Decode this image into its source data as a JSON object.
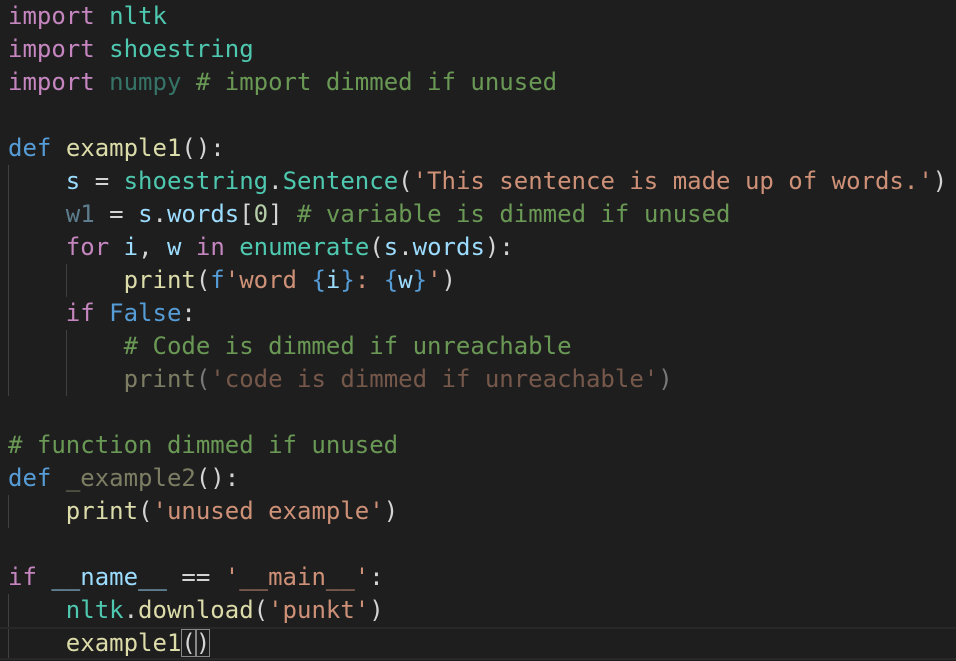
{
  "editor": {
    "lines": [
      [
        {
          "t": "import",
          "c": "kw"
        },
        {
          "t": " ",
          "c": "txt"
        },
        {
          "t": "nltk",
          "c": "mod"
        }
      ],
      [
        {
          "t": "import",
          "c": "kw"
        },
        {
          "t": " ",
          "c": "txt"
        },
        {
          "t": "shoestring",
          "c": "mod"
        }
      ],
      [
        {
          "t": "import",
          "c": "kw"
        },
        {
          "t": " ",
          "c": "txt"
        },
        {
          "t": "numpy",
          "c": "mod-dim"
        },
        {
          "t": " ",
          "c": "txt"
        },
        {
          "t": "# import dimmed if unused",
          "c": "cmt"
        }
      ],
      [],
      [
        {
          "t": "def",
          "c": "def"
        },
        {
          "t": " ",
          "c": "txt"
        },
        {
          "t": "example1",
          "c": "fn"
        },
        {
          "t": "():",
          "c": "txt"
        }
      ],
      [
        {
          "t": "    ",
          "c": "txt"
        },
        {
          "t": "s",
          "c": "var"
        },
        {
          "t": " = ",
          "c": "txt"
        },
        {
          "t": "shoestring",
          "c": "mod"
        },
        {
          "t": ".",
          "c": "txt"
        },
        {
          "t": "Sentence",
          "c": "mod"
        },
        {
          "t": "(",
          "c": "txt"
        },
        {
          "t": "'This sentence is made up of words.'",
          "c": "str"
        },
        {
          "t": ")",
          "c": "txt"
        }
      ],
      [
        {
          "t": "    ",
          "c": "txt"
        },
        {
          "t": "w1",
          "c": "var-dim"
        },
        {
          "t": " = ",
          "c": "txt"
        },
        {
          "t": "s",
          "c": "var"
        },
        {
          "t": ".",
          "c": "txt"
        },
        {
          "t": "words",
          "c": "var"
        },
        {
          "t": "[",
          "c": "txt"
        },
        {
          "t": "0",
          "c": "num"
        },
        {
          "t": "] ",
          "c": "txt"
        },
        {
          "t": "# variable is dimmed if unused",
          "c": "cmt"
        }
      ],
      [
        {
          "t": "    ",
          "c": "txt"
        },
        {
          "t": "for",
          "c": "kw"
        },
        {
          "t": " ",
          "c": "txt"
        },
        {
          "t": "i",
          "c": "var"
        },
        {
          "t": ", ",
          "c": "txt"
        },
        {
          "t": "w",
          "c": "var"
        },
        {
          "t": " ",
          "c": "txt"
        },
        {
          "t": "in",
          "c": "kw"
        },
        {
          "t": " ",
          "c": "txt"
        },
        {
          "t": "enumerate",
          "c": "mod"
        },
        {
          "t": "(",
          "c": "txt"
        },
        {
          "t": "s",
          "c": "var"
        },
        {
          "t": ".",
          "c": "txt"
        },
        {
          "t": "words",
          "c": "var"
        },
        {
          "t": "):",
          "c": "txt"
        }
      ],
      [
        {
          "t": "        ",
          "c": "txt"
        },
        {
          "t": "print",
          "c": "fn"
        },
        {
          "t": "(",
          "c": "txt"
        },
        {
          "t": "f",
          "c": "def"
        },
        {
          "t": "'word ",
          "c": "str"
        },
        {
          "t": "{",
          "c": "def"
        },
        {
          "t": "i",
          "c": "var"
        },
        {
          "t": "}",
          "c": "def"
        },
        {
          "t": ": ",
          "c": "str"
        },
        {
          "t": "{",
          "c": "def"
        },
        {
          "t": "w",
          "c": "var"
        },
        {
          "t": "}",
          "c": "def"
        },
        {
          "t": "'",
          "c": "str"
        },
        {
          "t": ")",
          "c": "txt"
        }
      ],
      [
        {
          "t": "    ",
          "c": "txt"
        },
        {
          "t": "if",
          "c": "kw"
        },
        {
          "t": " ",
          "c": "txt"
        },
        {
          "t": "False",
          "c": "def"
        },
        {
          "t": ":",
          "c": "txt"
        }
      ],
      [
        {
          "t": "        ",
          "c": "txt"
        },
        {
          "t": "# Code is dimmed if unreachable",
          "c": "cmt"
        }
      ],
      [
        {
          "t": "        ",
          "c": "txt"
        },
        {
          "t": "print",
          "c": "fn-dim"
        },
        {
          "t": "(",
          "c": "txt-dim"
        },
        {
          "t": "'code is dimmed if unreachable'",
          "c": "str-dim"
        },
        {
          "t": ")",
          "c": "txt-dim"
        }
      ],
      [],
      [
        {
          "t": "# function dimmed if unused",
          "c": "cmt"
        }
      ],
      [
        {
          "t": "def",
          "c": "def"
        },
        {
          "t": " ",
          "c": "txt"
        },
        {
          "t": "_example2",
          "c": "fn-dim"
        },
        {
          "t": "():",
          "c": "txt"
        }
      ],
      [
        {
          "t": "    ",
          "c": "txt"
        },
        {
          "t": "print",
          "c": "fn"
        },
        {
          "t": "(",
          "c": "txt"
        },
        {
          "t": "'unused example'",
          "c": "str"
        },
        {
          "t": ")",
          "c": "txt"
        }
      ],
      [],
      [
        {
          "t": "if",
          "c": "kw"
        },
        {
          "t": " ",
          "c": "txt"
        },
        {
          "t": "__name__",
          "c": "var"
        },
        {
          "t": " == ",
          "c": "txt"
        },
        {
          "t": "'__main__'",
          "c": "str"
        },
        {
          "t": ":",
          "c": "txt"
        }
      ],
      [
        {
          "t": "    ",
          "c": "txt"
        },
        {
          "t": "nltk",
          "c": "mod"
        },
        {
          "t": ".",
          "c": "txt"
        },
        {
          "t": "download",
          "c": "fn"
        },
        {
          "t": "(",
          "c": "txt"
        },
        {
          "t": "'punkt'",
          "c": "str"
        },
        {
          "t": ")",
          "c": "txt"
        }
      ],
      [
        {
          "t": "    ",
          "c": "txt"
        },
        {
          "t": "example1",
          "c": "fn"
        },
        {
          "t": "(",
          "c": "brmatch"
        },
        {
          "t": ")",
          "c": "brmatch"
        }
      ]
    ],
    "current_line": 19,
    "indent_guides": [
      {
        "level": 0,
        "from_line": 5,
        "to_line": 11
      },
      {
        "level": 1,
        "from_line": 8,
        "to_line": 8
      },
      {
        "level": 1,
        "from_line": 10,
        "to_line": 11
      },
      {
        "level": 0,
        "from_line": 15,
        "to_line": 15
      },
      {
        "level": 0,
        "from_line": 18,
        "to_line": 19
      }
    ]
  }
}
